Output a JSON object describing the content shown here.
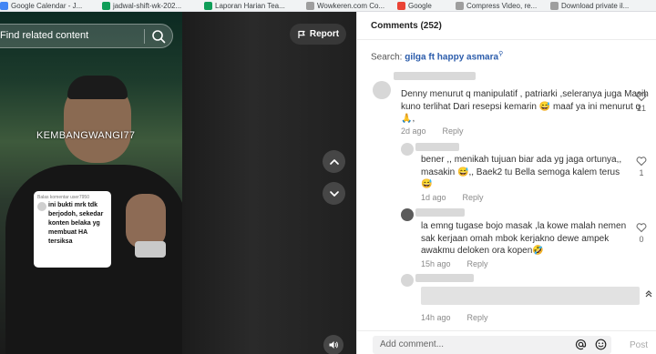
{
  "bookmarks": [
    {
      "label": "Google Calendar - J...",
      "color": "#4285f4"
    },
    {
      "label": "jadwal-shift-wk-202...",
      "color": "#0f9d58"
    },
    {
      "label": "Laporan Harian Tea...",
      "color": "#0f9d58"
    },
    {
      "label": "Wowkeren.com Co...",
      "color": "#9e9e9e"
    },
    {
      "label": "Google",
      "color": "#ea4335"
    },
    {
      "label": "Compress Video, re...",
      "color": "#9e9e9e"
    },
    {
      "label": "Download private il...",
      "color": "#9e9e9e"
    }
  ],
  "video": {
    "search_placeholder": "Find related content",
    "report_label": "Report",
    "watermark": "KEMBANGWANGI77",
    "overlay_reply_to": "Balas komentar user7950",
    "overlay_text": "ini bukti mrk tdk berjodoh, sekedar konten belaka yg membuat HA tersiksa"
  },
  "comments_panel": {
    "title": "Comments (252)",
    "search_prefix": "Search: ",
    "search_keyword": "gilga ft happy asmara",
    "search_icon": "search-icon",
    "comments": [
      {
        "text": "Denny menurut q manipulatif , patriarki ,seleranya juga Masih kuno terlihat Dari resepsi kemarin 😅 maaf ya ini menurut q 🙏,",
        "time": "2d ago",
        "reply": "Reply",
        "likes": "21"
      },
      {
        "text": "bener ,, menikah tujuan biar ada yg jaga ortunya,, masakin 😅,, Baek2 tu Bella semoga kalem terus😅",
        "time": "1d ago",
        "reply": "Reply",
        "likes": "1"
      },
      {
        "text": "la emng tugase bojo masak ,la kowe malah nemen sak kerjaan omah mbok kerjakno dewe ampek awakmu deloken ora kopen🤣",
        "time": "15h ago",
        "reply": "Reply",
        "likes": "0"
      },
      {
        "text": "",
        "time": "14h ago",
        "reply": "Reply",
        "likes": ""
      }
    ],
    "add_comment_placeholder": "Add comment...",
    "post_label": "Post"
  }
}
